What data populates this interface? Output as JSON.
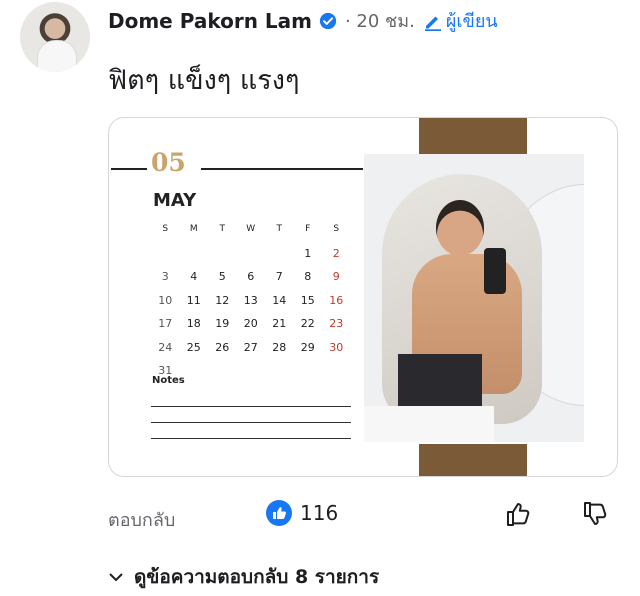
{
  "comment": {
    "author": "Dome Pakorn Lam",
    "time": "· 20 ชม.",
    "role": "ผู้เขียน",
    "text": "ฟิตๆ แข็งๆ แรงๆ"
  },
  "calendar": {
    "month_number": "05",
    "month_name": "MAY",
    "weekdays": [
      "S",
      "M",
      "T",
      "W",
      "T",
      "F",
      "S"
    ],
    "weeks": [
      [
        "",
        "",
        "",
        "",
        "",
        "1",
        "2"
      ],
      [
        "3",
        "4",
        "5",
        "6",
        "7",
        "8",
        "9"
      ],
      [
        "10",
        "11",
        "12",
        "13",
        "14",
        "15",
        "16"
      ],
      [
        "17",
        "18",
        "19",
        "20",
        "21",
        "22",
        "23"
      ],
      [
        "24",
        "25",
        "26",
        "27",
        "28",
        "29",
        "30"
      ],
      [
        "31",
        "",
        "",
        "",
        "",
        "",
        ""
      ]
    ],
    "notes_label": "Notes"
  },
  "actions": {
    "reply_label": "ตอบกลับ",
    "like_count": "116",
    "view_replies": "ดูข้อความตอบกลับ 8 รายการ"
  },
  "colors": {
    "brand_blue": "#1877f2",
    "meta_gray": "#65676b",
    "strap_brown": "#7b5a38",
    "gold": "#c9a46d"
  }
}
